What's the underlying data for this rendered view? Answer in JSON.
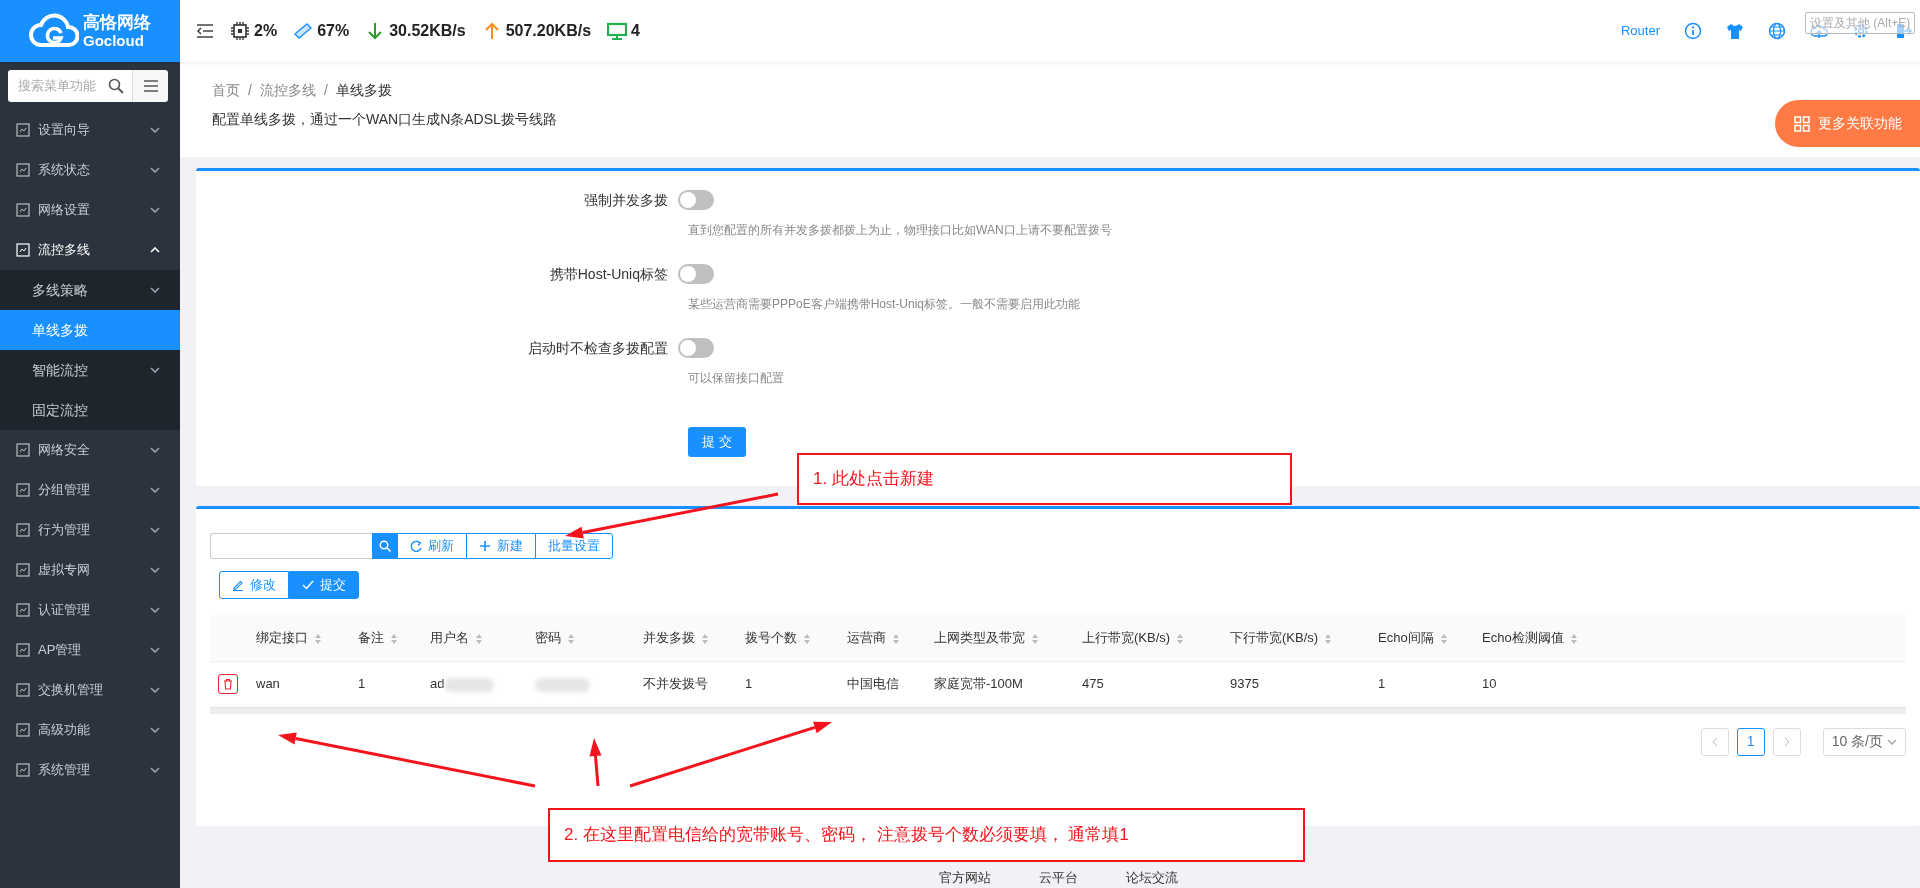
{
  "logo": {
    "name": "高恪网络",
    "sub": "Gocloud"
  },
  "header": {
    "stats": [
      {
        "kind": "cpu",
        "text": "2%"
      },
      {
        "kind": "memory",
        "text": "67%"
      },
      {
        "kind": "down",
        "text": "30.52KB/s"
      },
      {
        "kind": "up",
        "text": "507.20KB/s"
      },
      {
        "kind": "devices",
        "text": "4"
      }
    ],
    "device_name": "Router",
    "tooltip": "设置及其他 (Alt+E)"
  },
  "sidebar": {
    "search_placeholder": "搜索菜单功能",
    "items": [
      {
        "label": "设置向导",
        "expanded": false
      },
      {
        "label": "系统状态",
        "expanded": false
      },
      {
        "label": "网络设置",
        "expanded": false
      },
      {
        "label": "流控多线",
        "expanded": true,
        "children": [
          {
            "label": "多线策略",
            "kind": "group",
            "selected": false
          },
          {
            "label": "单线多拨",
            "kind": "leaf",
            "selected": true
          },
          {
            "label": "智能流控",
            "kind": "group",
            "selected": false
          },
          {
            "label": "固定流控",
            "kind": "leaf",
            "selected": false
          }
        ]
      },
      {
        "label": "网络安全",
        "expanded": false
      },
      {
        "label": "分组管理",
        "expanded": false
      },
      {
        "label": "行为管理",
        "expanded": false
      },
      {
        "label": "虚拟专网",
        "expanded": false
      },
      {
        "label": "认证管理",
        "expanded": false
      },
      {
        "label": "AP管理",
        "expanded": false
      },
      {
        "label": "交换机管理",
        "expanded": false
      },
      {
        "label": "高级功能",
        "expanded": false
      },
      {
        "label": "系统管理",
        "expanded": false
      }
    ]
  },
  "breadcrumb": [
    {
      "kind": "link",
      "text": "首页"
    },
    {
      "kind": "separator",
      "text": "/"
    },
    {
      "kind": "link",
      "text": "流控多线"
    },
    {
      "kind": "separator",
      "text": "/"
    },
    {
      "kind": "current",
      "text": "单线多拨"
    }
  ],
  "description": "配置单线多拨，通过一个WAN口生成N条ADSL拨号线路",
  "more_button": "更多关联功能",
  "settings": [
    {
      "label": "强制并发多拨",
      "on": false,
      "help": "直到您配置的所有并发多拨都拨上为止，物理接口比如WAN口上请不要配置拨号"
    },
    {
      "label": "携带Host-Uniq标签",
      "on": false,
      "help": "某些运营商需要PPPoE客户端携带Host-Uniq标签。一般不需要启用此功能"
    },
    {
      "label": "启动时不检查多拨配置",
      "on": false,
      "help": "可以保留接口配置"
    }
  ],
  "submit": "提 交",
  "toolbar": {
    "buttons": [
      "刷新",
      "新建",
      "批量设置"
    ],
    "edit_buttons": [
      {
        "label": "修改",
        "selected": false
      },
      {
        "label": "提交",
        "selected": true
      }
    ]
  },
  "table": {
    "columns": [
      "绑定接口",
      "备注",
      "用户名",
      "密码",
      "并发多拨",
      "拨号个数",
      "运营商",
      "上网类型及带宽",
      "上行带宽(KB/s)",
      "下行带宽(KB/s)",
      "Echo间隔",
      "Echo检测阈值"
    ],
    "rows": [
      {
        "cells": [
          "wan",
          "1",
          "ad",
          null,
          "不并发拨号",
          "1",
          "中国电信",
          "家庭宽带-100M",
          "475",
          "9375",
          "1",
          "10"
        ]
      }
    ]
  },
  "pagination": {
    "pages": [
      {
        "label": "1",
        "selected": true
      }
    ],
    "page_size": "10 条/页"
  },
  "annotations": [
    {
      "text": "1. 此处点击新建"
    },
    {
      "text": "2. 在这里配置电信给的宽带账号、密码， 注意拨号个数必须要填， 通常填1"
    }
  ],
  "footer": [
    "官方网站",
    "云平台",
    "论坛交流"
  ]
}
